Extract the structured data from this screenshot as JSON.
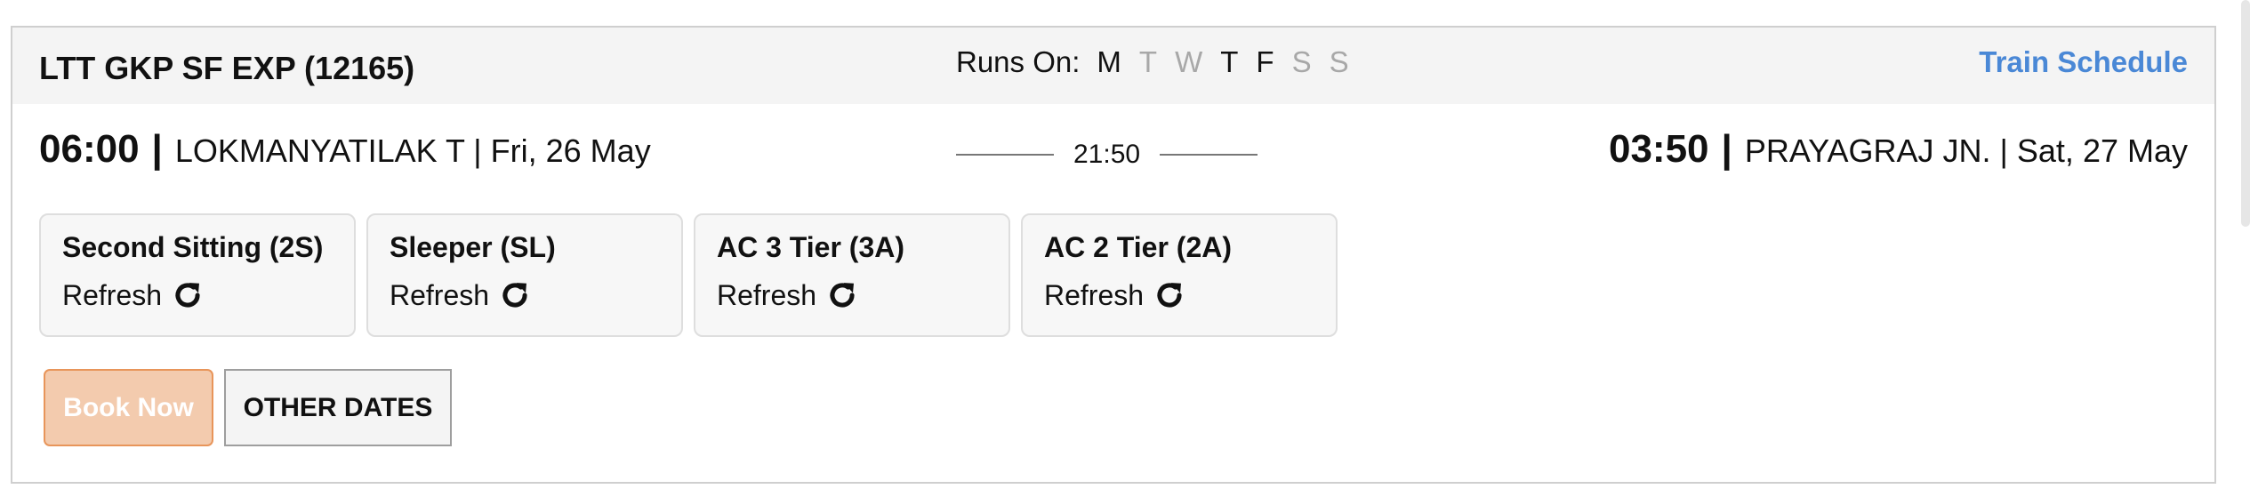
{
  "train": {
    "name": "LTT GKP SF EXP (12165)",
    "runs_on_label": "Runs On:",
    "days": [
      {
        "letter": "M",
        "runs": true
      },
      {
        "letter": "T",
        "runs": false
      },
      {
        "letter": "W",
        "runs": false
      },
      {
        "letter": "T",
        "runs": true
      },
      {
        "letter": "F",
        "runs": true
      },
      {
        "letter": "S",
        "runs": false
      },
      {
        "letter": "S",
        "runs": false
      }
    ],
    "schedule_link": "Train Schedule"
  },
  "journey": {
    "departure": {
      "time": "06:00",
      "separator": "|",
      "details": "LOKMANYATILAK T | Fri, 26 May"
    },
    "duration": "21:50",
    "arrival": {
      "time": "03:50",
      "separator": "|",
      "details": "PRAYAGRAJ JN. | Sat, 27 May"
    }
  },
  "classes": [
    {
      "name": "Second Sitting (2S)",
      "action": "Refresh"
    },
    {
      "name": "Sleeper (SL)",
      "action": "Refresh"
    },
    {
      "name": "AC 3 Tier (3A)",
      "action": "Refresh"
    },
    {
      "name": "AC 2 Tier (2A)",
      "action": "Refresh"
    }
  ],
  "buttons": {
    "book_now": "Book Now",
    "other_dates": "OTHER DATES"
  },
  "colors": {
    "link": "#4a88d6",
    "book_bg": "#f3cbae",
    "book_border": "#e8955a",
    "day_off": "#a8a8a8"
  }
}
